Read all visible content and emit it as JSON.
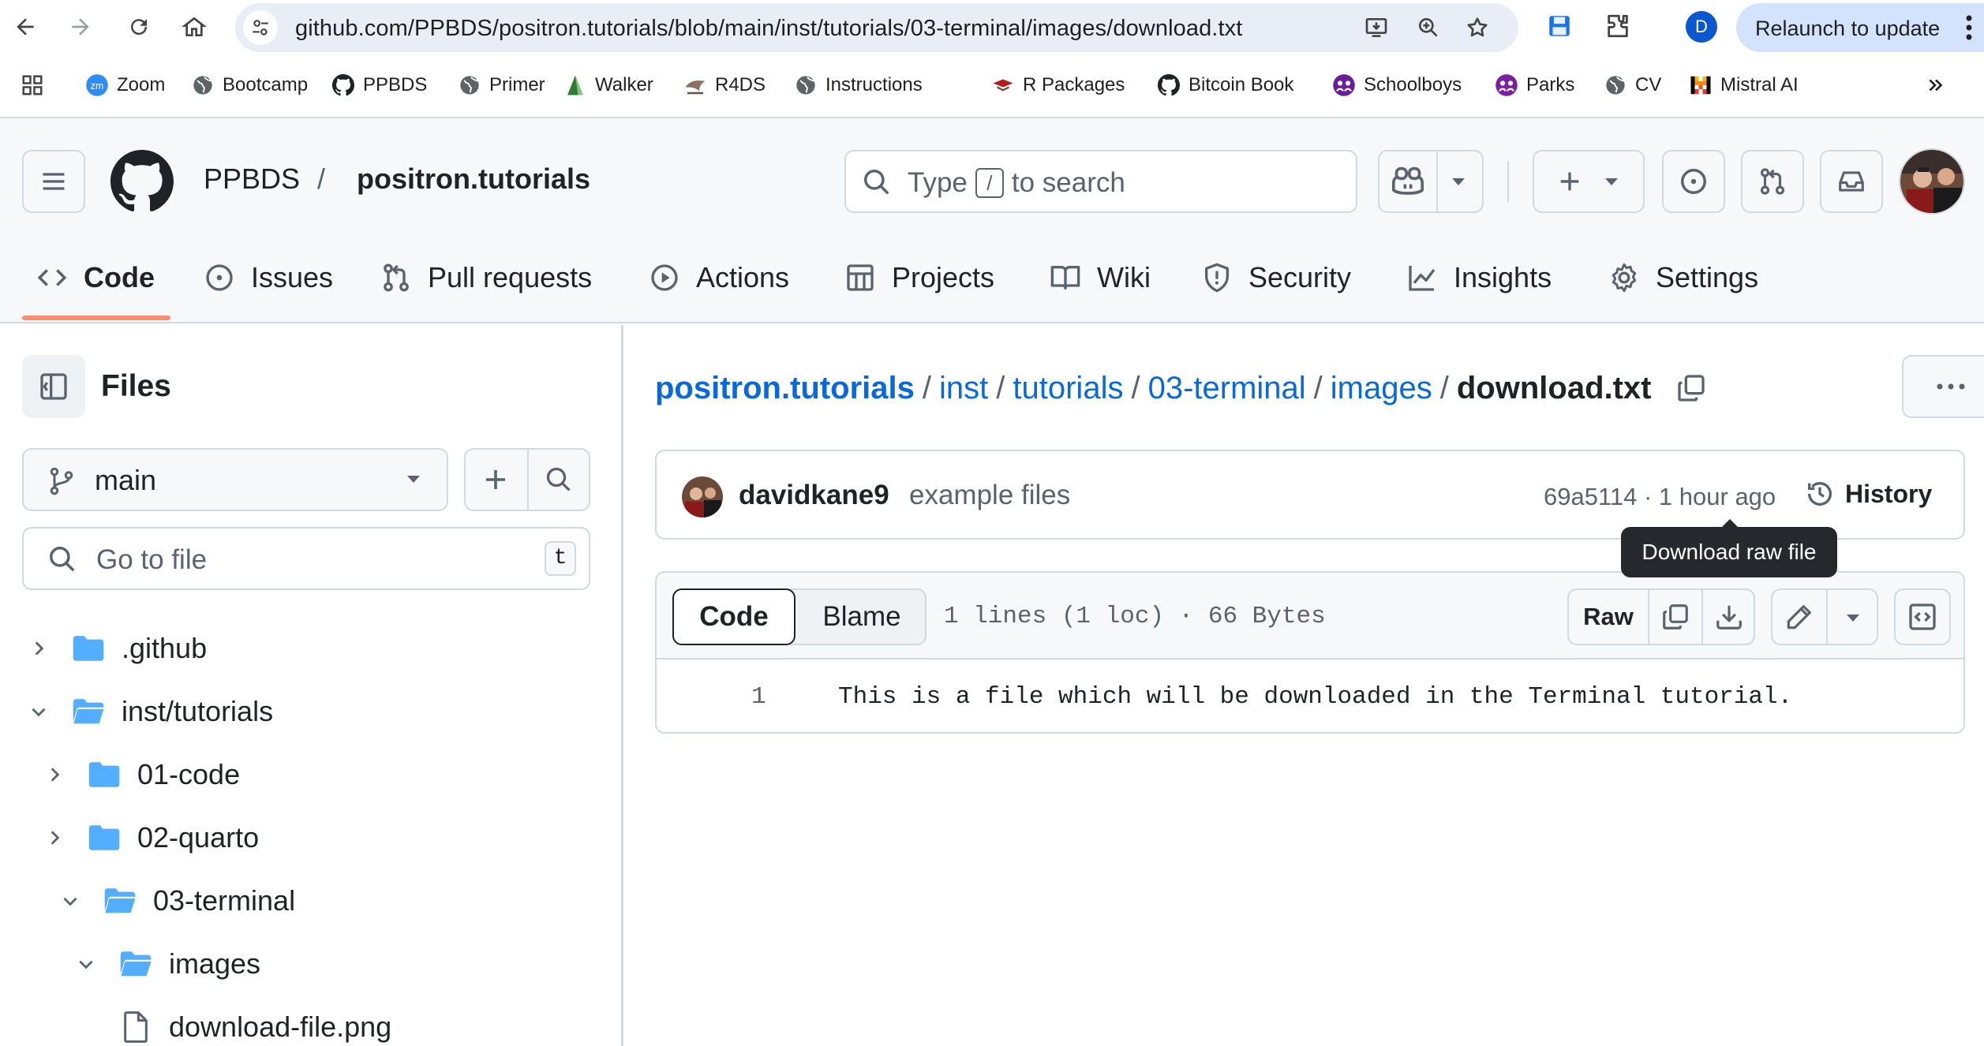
{
  "browser": {
    "url": "github.com/PPBDS/positron.tutorials/blob/main/inst/tutorials/03-terminal/images/download.txt",
    "profile_initial": "D",
    "relaunch_label": "Relaunch to update",
    "bookmarks": [
      {
        "label": "Zoom",
        "icon": "zoom-icon"
      },
      {
        "label": "Bootcamp",
        "icon": "globe-icon"
      },
      {
        "label": "PPBDS",
        "icon": "github-icon"
      },
      {
        "label": "Primer",
        "icon": "globe-icon"
      },
      {
        "label": "Walker",
        "icon": "walker-icon"
      },
      {
        "label": "R4DS",
        "icon": "r4ds-icon"
      },
      {
        "label": "Instructions",
        "icon": "globe-icon"
      },
      {
        "label": "R Packages",
        "icon": "rpackages-icon"
      },
      {
        "label": "Bitcoin Book",
        "icon": "github-icon"
      },
      {
        "label": "Schoolboys",
        "icon": "schoolboys-icon"
      },
      {
        "label": "Parks",
        "icon": "parks-icon"
      },
      {
        "label": "CV",
        "icon": "globe-icon"
      },
      {
        "label": "Mistral AI",
        "icon": "mistral-icon"
      }
    ]
  },
  "header": {
    "owner": "PPBDS",
    "separator": "/",
    "repo": "positron.tutorials",
    "search": {
      "prefix": "Type",
      "key": "/",
      "suffix": "to search"
    }
  },
  "tabs": [
    {
      "label": "Code",
      "icon": "code-icon",
      "active": true
    },
    {
      "label": "Issues",
      "icon": "issue-icon"
    },
    {
      "label": "Pull requests",
      "icon": "pull-request-icon"
    },
    {
      "label": "Actions",
      "icon": "play-icon"
    },
    {
      "label": "Projects",
      "icon": "table-icon"
    },
    {
      "label": "Wiki",
      "icon": "book-icon"
    },
    {
      "label": "Security",
      "icon": "shield-icon"
    },
    {
      "label": "Insights",
      "icon": "graph-icon"
    },
    {
      "label": "Settings",
      "icon": "gear-icon"
    }
  ],
  "sidebar": {
    "title": "Files",
    "branch": "main",
    "goto_placeholder": "Go to file",
    "goto_key": "t",
    "tree": [
      {
        "label": ".github",
        "type": "folder",
        "expanded": false,
        "depth": 0
      },
      {
        "label": "inst/tutorials",
        "type": "folder",
        "expanded": true,
        "depth": 0
      },
      {
        "label": "01-code",
        "type": "folder",
        "expanded": false,
        "depth": 1
      },
      {
        "label": "02-quarto",
        "type": "folder",
        "expanded": false,
        "depth": 1
      },
      {
        "label": "03-terminal",
        "type": "folder",
        "expanded": true,
        "depth": 1
      },
      {
        "label": "images",
        "type": "folder",
        "expanded": true,
        "depth": 2
      },
      {
        "label": "download-file.png",
        "type": "file",
        "depth": 3
      }
    ]
  },
  "breadcrumb": {
    "parts": [
      "positron.tutorials",
      "inst",
      "tutorials",
      "03-terminal",
      "images"
    ],
    "sep": "/",
    "current": "download.txt"
  },
  "commit": {
    "author": "davidkane9",
    "message": "example files",
    "meta": "69a5114 · 1 hour ago",
    "history_label": "History"
  },
  "tooltip": "Download raw file",
  "file": {
    "code_tab": "Code",
    "blame_tab": "Blame",
    "info": "1 lines (1 loc) · 66 Bytes",
    "raw_label": "Raw",
    "lines": [
      {
        "no": "1",
        "text": "This is a file which will be downloaded in the Terminal tutorial."
      }
    ]
  },
  "colors": {
    "link": "#0969da",
    "tab_underline": "#fd8c73",
    "folder": "#54aeff",
    "relaunch_bg": "#d3e3fd"
  }
}
